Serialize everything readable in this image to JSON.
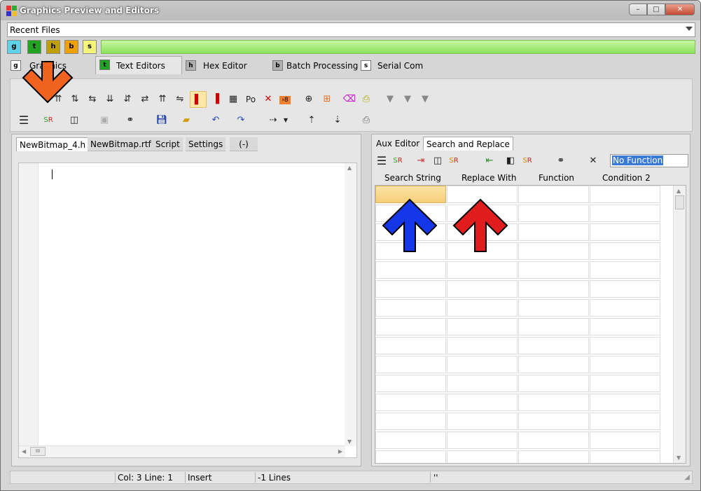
{
  "window": {
    "title": "Graphics Preview and Editors",
    "buttons": {
      "minimize": "–",
      "maximize": "□",
      "close": "✕"
    }
  },
  "recent_files": {
    "value": "Recent Files"
  },
  "quick_buttons": [
    {
      "letter": "g",
      "color": "#5ed2e8"
    },
    {
      "letter": "t",
      "color": "#22a322"
    },
    {
      "letter": "h",
      "color": "#c0a000"
    },
    {
      "letter": "b",
      "color": "#f0a000"
    },
    {
      "letter": "s",
      "color": "#f5f57a"
    }
  ],
  "main_tabs": [
    {
      "badge": "g",
      "label": "Graphics",
      "badge_color": "#ffffff"
    },
    {
      "badge": "t",
      "label": "Text Editors",
      "badge_color": "#22a322"
    },
    {
      "badge": "h",
      "label": "Hex Editor",
      "badge_color": "#b0b0b0"
    },
    {
      "badge": "b",
      "label": "Batch Processing",
      "badge_color": "#b0b0b0"
    },
    {
      "badge": "s",
      "label": "Serial Com",
      "badge_color": "#ffffff"
    }
  ],
  "toolbar": {
    "row1_text_po": "Po",
    "row1_icons": [
      "arrows-up-icon",
      "arrows-left-icon",
      "arrows-down-icon",
      "updown-icon",
      "split-icon",
      "upup-icon",
      "split2-icon",
      "column-icon",
      "column2-icon",
      "misc-icon",
      "po-label",
      "delete-x-icon",
      "badge8-icon",
      "target-icon",
      "align-icon",
      "eraser-icon",
      "print-icon",
      "flag1-icon",
      "flag2-icon",
      "flag3-icon"
    ]
  },
  "doc_tabs": [
    {
      "label": "NewBitmap_4.h"
    },
    {
      "label": "NewBitmap.rtf"
    },
    {
      "label": "Script"
    },
    {
      "label": "Settings"
    },
    {
      "label": "(-)"
    }
  ],
  "left_scroll": {
    "hthumb": "III"
  },
  "right_tabs": [
    {
      "label": "Aux Editor"
    },
    {
      "label": "Search and Replace"
    }
  ],
  "function_field": {
    "value": "No Function"
  },
  "grid_headers": [
    "Search String",
    "Replace With",
    "Function",
    "Condition 2"
  ],
  "status": {
    "position": "Col: 3 Line: 1",
    "mode": "Insert",
    "lines": "-1 Lines",
    "extra": "''"
  },
  "annotations": {
    "orange_arrow": "#f0621f",
    "blue_arrow": "#1637e8",
    "red_arrow": "#e01d1d"
  }
}
